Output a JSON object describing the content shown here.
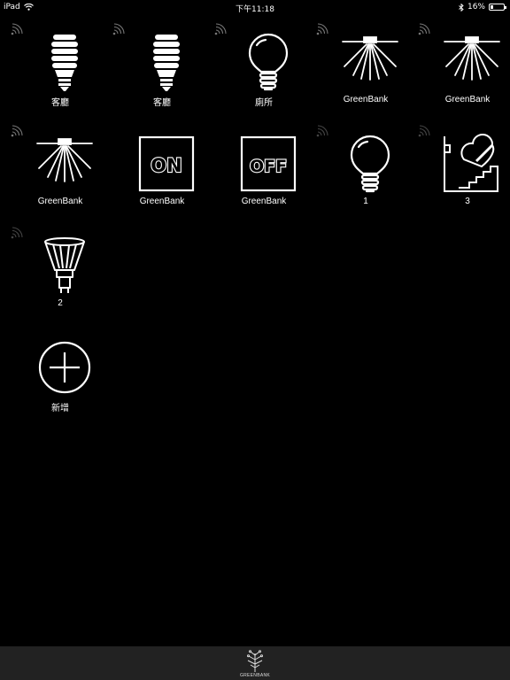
{
  "status_bar": {
    "carrier": "iPad",
    "time": "下午11:18",
    "battery": "16%"
  },
  "devices": [
    {
      "label": "客廳",
      "icon": "cfl-bulb-icon",
      "connected": true
    },
    {
      "label": "客廳",
      "icon": "cfl-bulb-icon",
      "connected": true
    },
    {
      "label": "廁所",
      "icon": "light-bulb-icon",
      "connected": true
    },
    {
      "label": "GreenBank",
      "icon": "ceiling-light-icon",
      "connected": true
    },
    {
      "label": "GreenBank",
      "icon": "ceiling-light-icon",
      "connected": true
    },
    {
      "label": "GreenBank",
      "icon": "ceiling-light-icon",
      "connected": true
    },
    {
      "label": "GreenBank",
      "icon": "on-switch-icon",
      "switch_text": "ON",
      "connected": false
    },
    {
      "label": "GreenBank",
      "icon": "off-switch-icon",
      "switch_text": "OFF",
      "connected": false
    },
    {
      "label": "1",
      "icon": "light-bulb-icon",
      "connected": false
    },
    {
      "label": "3",
      "icon": "stair-light-icon",
      "connected": false
    },
    {
      "label": "2",
      "icon": "spotlight-bulb-icon",
      "connected": false
    }
  ],
  "add_device": {
    "label": "新增",
    "icon": "plus-circle-icon"
  },
  "footer": {
    "logo_text": "GREENBANK",
    "icon": "tree-logo-icon"
  }
}
